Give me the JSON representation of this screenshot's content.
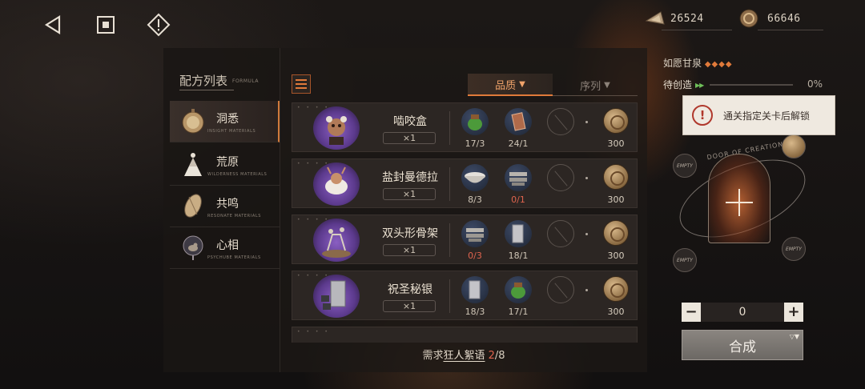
{
  "topbar": {
    "back_icon": "back-triangle-icon",
    "home_icon": "square-home-icon",
    "info_icon": "diamond-exclaim-icon",
    "resources": [
      {
        "icon": "sharpodonty-icon",
        "value": "26524"
      },
      {
        "icon": "oneiric-shell-icon",
        "value": "66646"
      }
    ]
  },
  "sidebar": {
    "title": "配方列表",
    "title_sub": "FORMULA",
    "categories": [
      {
        "label": "洞悉",
        "sub": "INSIGHT MATERIALS",
        "icon": "pocket-watch-icon"
      },
      {
        "label": "荒原",
        "sub": "WILDERNESS MATERIALS",
        "icon": "dress-figure-icon"
      },
      {
        "label": "共鸣",
        "sub": "RESONATE MATERIALS",
        "icon": "shell-icon"
      },
      {
        "label": "心相",
        "sub": "PSYCHUBE MATERIALS",
        "icon": "bird-glass-icon"
      }
    ]
  },
  "sort": {
    "quality": "品质",
    "sequence": "序列"
  },
  "recipes": [
    {
      "name": "啮咬盒",
      "qty": "×1",
      "materials": [
        {
          "icon": "green-jar-icon",
          "count": "17/3",
          "short": false
        },
        {
          "icon": "card-icon",
          "count": "24/1",
          "short": false
        }
      ],
      "cost": "300"
    },
    {
      "name": "盐封曼德拉",
      "qty": "×1",
      "materials": [
        {
          "icon": "salt-bowl-icon",
          "count": "8/3",
          "short": false
        },
        {
          "icon": "metal-bars-icon",
          "count": "0/1",
          "short": true
        }
      ],
      "cost": "300"
    },
    {
      "name": "双头形骨架",
      "qty": "×1",
      "materials": [
        {
          "icon": "metal-bars-icon",
          "count": "0/3",
          "short": true
        },
        {
          "icon": "silver-ingot-icon",
          "count": "18/1",
          "short": false
        }
      ],
      "cost": "300"
    },
    {
      "name": "祝圣秘银",
      "qty": "×1",
      "materials": [
        {
          "icon": "silver-ingot-icon",
          "count": "18/3",
          "short": false
        },
        {
          "icon": "green-jar-icon",
          "count": "17/1",
          "short": false
        }
      ],
      "cost": "300"
    }
  ],
  "footer": {
    "prefix": "需求",
    "item": "狂人絮语",
    "have": "2",
    "total": "/8"
  },
  "right": {
    "wish_label": "如愿甘泉",
    "wish_stars": "◆◆◆◆",
    "pending_label": "待创造",
    "pending_pct": "0%",
    "pending_fraction": 0,
    "toast_text": "通关指定关卡后解锁",
    "ring_text": "DOOR OF CREATION",
    "empty_label": "EMPTY",
    "stepper_minus": "−",
    "stepper_value": "0",
    "stepper_plus": "+",
    "synth_label": "合成"
  },
  "colors": {
    "accent": "#e07a3a",
    "shortage": "#e0644e",
    "portrait": "#5c3a8d"
  }
}
